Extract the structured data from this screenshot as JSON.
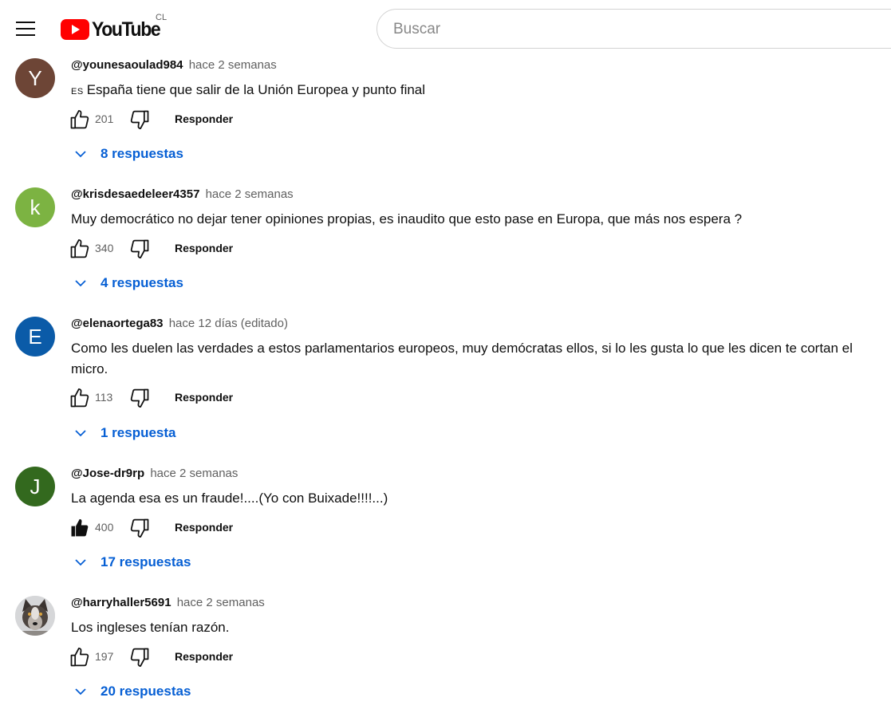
{
  "header": {
    "logo_text": "YouTube",
    "country_code": "CL",
    "search_placeholder": "Buscar"
  },
  "reply_label": "Responder",
  "comments": [
    {
      "avatar_letter": "Y",
      "avatar_color": "#6d4536",
      "author": "@younesaoulad984",
      "time": "hace 2 semanas",
      "lang_tag": "ES",
      "text": "España tiene que salir de la Unión Europea y punto final",
      "likes": "201",
      "liked": false,
      "replies": "8 respuestas"
    },
    {
      "avatar_letter": "k",
      "avatar_color": "#7cb342",
      "author": "@krisdesaedeleer4357",
      "time": "hace 2 semanas",
      "text": "Muy democrático no dejar tener opiniones propias, es inaudito que esto pase en Europa, que más nos espera ?",
      "likes": "340",
      "liked": false,
      "replies": "4 respuestas"
    },
    {
      "avatar_letter": "E",
      "avatar_color": "#0b5ba8",
      "author": "@elenaortega83",
      "time": "hace 12 días (editado)",
      "text": "Como les duelen las verdades a estos parlamentarios europeos, muy demócratas ellos, si lo les gusta lo que les dicen te cortan el micro.",
      "likes": "113",
      "liked": false,
      "replies": "1 respuesta"
    },
    {
      "avatar_letter": "J",
      "avatar_color": "#33691e",
      "author": "@Jose-dr9rp",
      "time": "hace 2 semanas",
      "text": "La agenda esa es un fraude!....(Yo con Buixade!!!!...)",
      "likes": "400",
      "liked": true,
      "replies": "17 respuestas"
    },
    {
      "avatar_image": "wolf-photo",
      "author": "@harryhaller5691",
      "time": "hace 2 semanas",
      "text": "Los ingleses tenían razón.",
      "likes": "197",
      "liked": false,
      "replies": "20 respuestas"
    }
  ]
}
